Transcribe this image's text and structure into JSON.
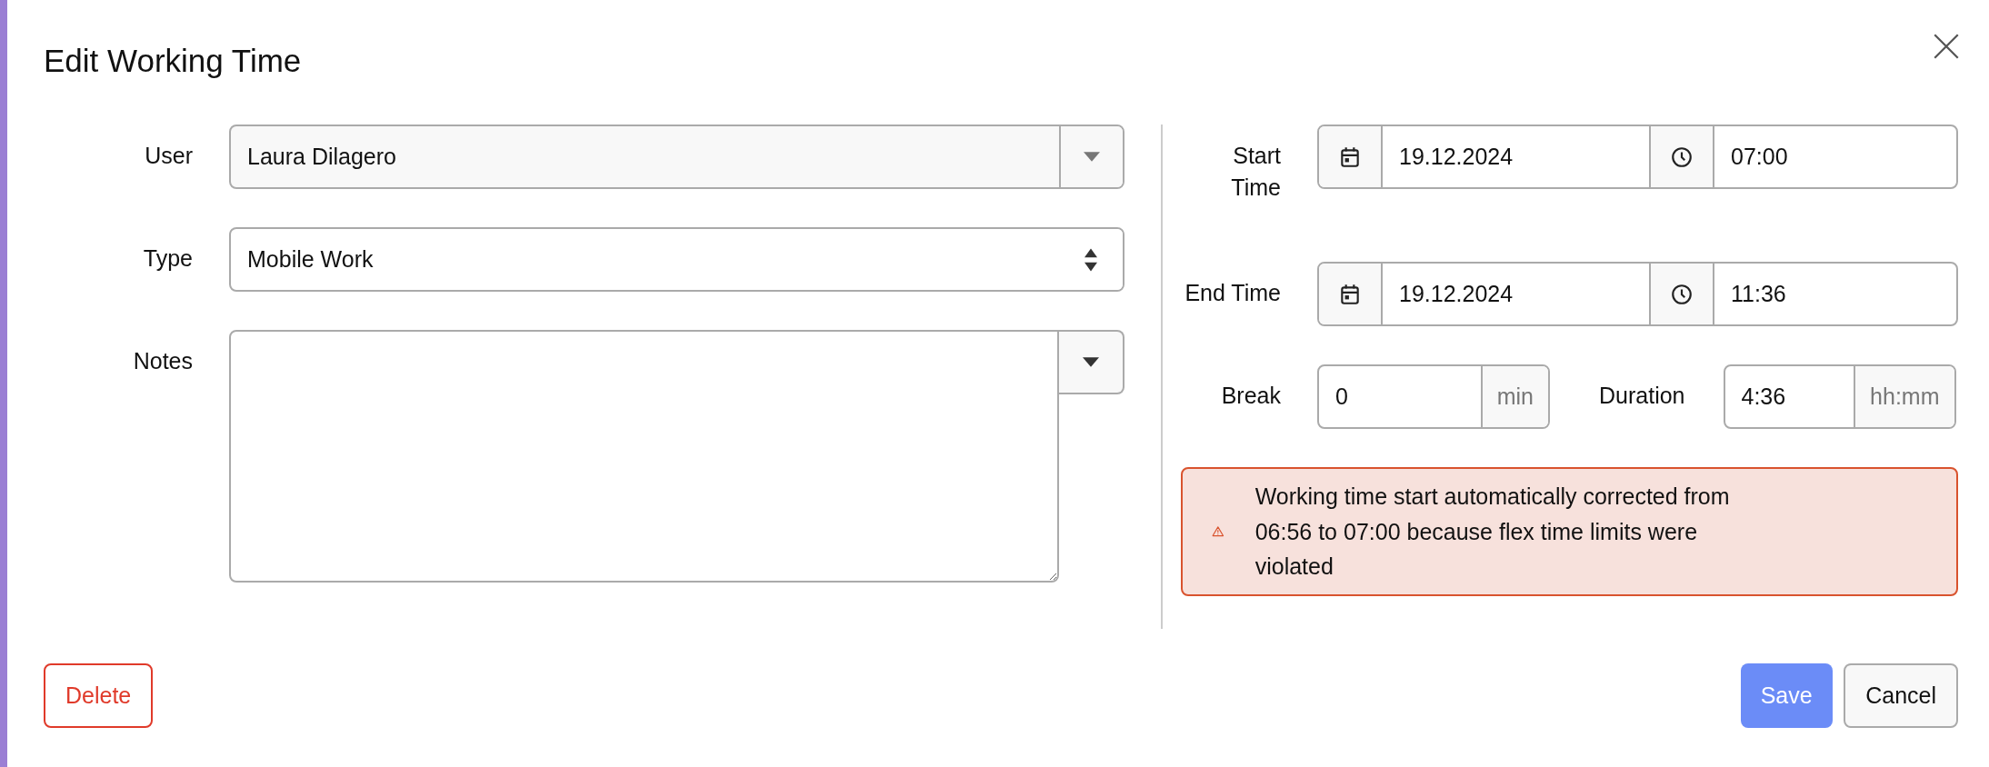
{
  "dialog": {
    "title": "Edit Working Time"
  },
  "left_fields": [
    {
      "label": "User",
      "kind": "combo",
      "value": "Laura Dilagero"
    },
    {
      "label": "Type",
      "kind": "select",
      "value": "Mobile Work"
    },
    {
      "label": "Notes",
      "kind": "textarea"
    }
  ],
  "time_rows": [
    {
      "label": "Start Time",
      "date": "19.12.2024",
      "time": "07:00"
    },
    {
      "label": "End Time",
      "date": "19.12.2024",
      "time": "11:36"
    }
  ],
  "amounts": [
    {
      "label": "Break",
      "value": "0",
      "unit": "min"
    },
    {
      "label": "Duration",
      "value": "4:36",
      "unit": "hh:mm"
    }
  ],
  "alert": {
    "text": "Working time start automatically corrected from 06:56 to 07:00 because flex time limits were violated"
  },
  "buttons": [
    {
      "label": "Delete",
      "kind": "danger"
    },
    {
      "label": "Save",
      "kind": "primary"
    },
    {
      "label": "Cancel",
      "kind": "secondary"
    }
  ]
}
